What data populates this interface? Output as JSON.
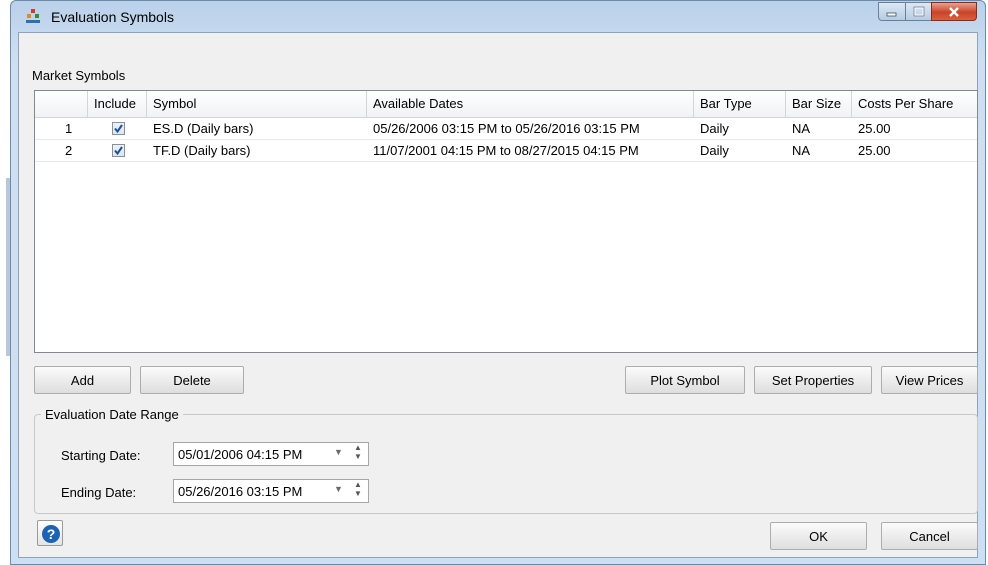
{
  "window": {
    "title": "Evaluation Symbols",
    "controls": {
      "minimize": "minimize-icon",
      "maximize": "maximize-icon",
      "close": "close-icon"
    }
  },
  "market": {
    "section_label": "Market Symbols",
    "columns": [
      "",
      "Include",
      "Symbol",
      "Available Dates",
      "Bar Type",
      "Bar Size",
      "Costs Per Share"
    ],
    "rows": [
      {
        "num": "1",
        "include": true,
        "symbol": "ES.D (Daily bars)",
        "dates": "05/26/2006 03:15 PM to 05/26/2016 03:15 PM",
        "bar_type": "Daily",
        "bar_size": "NA",
        "cost": "25.00"
      },
      {
        "num": "2",
        "include": true,
        "symbol": "TF.D (Daily bars)",
        "dates": "11/07/2001 04:15 PM to 08/27/2015 04:15 PM",
        "bar_type": "Daily",
        "bar_size": "NA",
        "cost": "25.00"
      }
    ]
  },
  "buttons": {
    "add": "Add",
    "delete": "Delete",
    "plot_symbol": "Plot Symbol",
    "set_properties": "Set Properties",
    "view_prices": "View Prices",
    "ok": "OK",
    "cancel": "Cancel"
  },
  "date_range": {
    "title": "Evaluation Date Range",
    "starting_label": "Starting Date:",
    "starting_value": "05/01/2006 04:15 PM",
    "ending_label": "Ending Date:",
    "ending_value": "05/26/2016 03:15 PM"
  },
  "colors": {
    "title_bar": "#c4d8ee",
    "client_bg": "#f0f0f0",
    "close_button": "#c9442a",
    "help_icon": "#1d63b4",
    "checkbox_check": "#1d4f91"
  }
}
